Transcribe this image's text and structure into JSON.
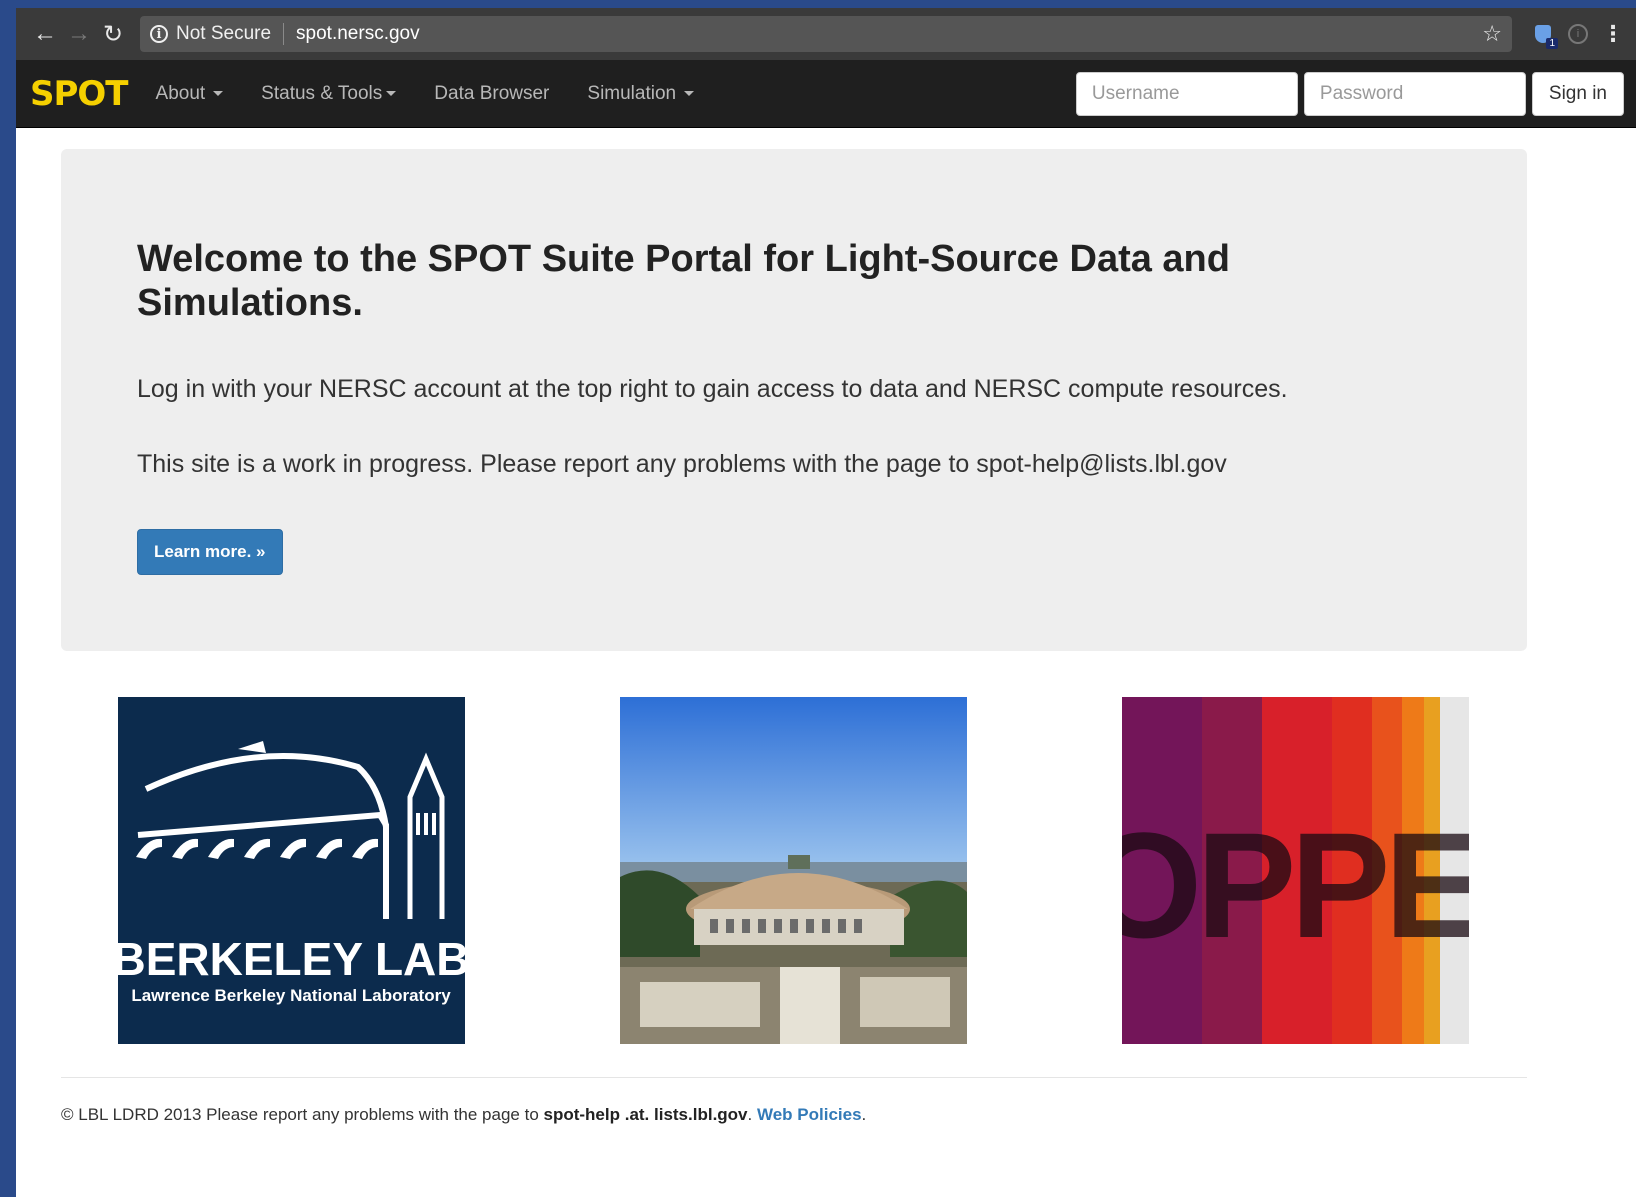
{
  "browser": {
    "security_label": "Not Secure",
    "url": "spot.nersc.gov",
    "extension_badge": "1"
  },
  "navbar": {
    "brand": "SPOT",
    "items": [
      {
        "label": "About"
      },
      {
        "label": "Status & Tools"
      },
      {
        "label": "Data Browser"
      },
      {
        "label": "Simulation"
      }
    ],
    "username_placeholder": "Username",
    "password_placeholder": "Password",
    "signin_label": "Sign in"
  },
  "jumbotron": {
    "heading": "Welcome to the SPOT Suite Portal for Light-Source Data and Simulations.",
    "paragraph1": "Log in with your NERSC account at the top right to gain access to data and NERSC compute resources.",
    "paragraph2": "This site is a work in progress. Please report any problems with the page to spot-help@lists.lbl.gov",
    "button_label": "Learn more. »"
  },
  "images": {
    "lab_logo_title": "BERKELEY LAB",
    "lab_logo_subtitle": "Lawrence Berkeley National Laboratory",
    "supercomputer_text": "HOPPER"
  },
  "footer": {
    "prefix": "© LBL LDRD 2013 Please report any problems with the page to ",
    "email": "spot-help .at. lists.lbl.gov",
    "sep": ". ",
    "link": "Web Policies",
    "suffix": "."
  },
  "colors": {
    "brand": "#f5d000",
    "navbar_bg": "#1f1f1f",
    "primary_button": "#337ab7",
    "jumbotron_bg": "#eeeeee"
  }
}
